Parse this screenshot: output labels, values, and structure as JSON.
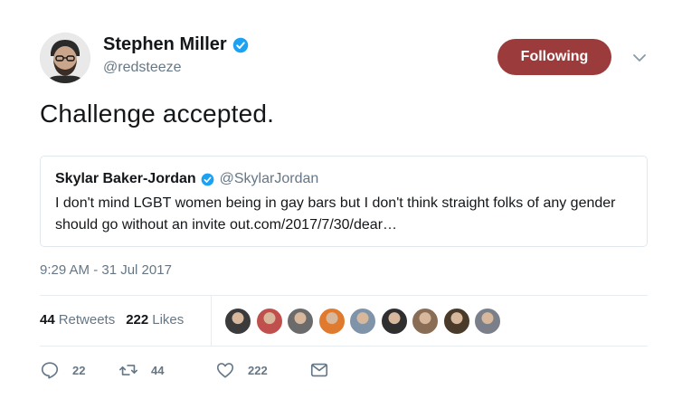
{
  "author": {
    "name": "Stephen Miller",
    "handle": "@redsteeze",
    "verified_icon": "verified-badge-icon"
  },
  "follow_button": {
    "label": "Following",
    "color": "#9b3b3b"
  },
  "tweet": {
    "text": "Challenge accepted."
  },
  "quote": {
    "name": "Skylar Baker-Jordan",
    "handle": "@SkylarJordan",
    "text": "I don't mind LGBT women being in gay bars but I don't think straight folks of any gender should go without an invite out.com/2017/7/30/dear…"
  },
  "timestamp": "9:29 AM - 31 Jul 2017",
  "stats": {
    "retweets_count": "44",
    "retweets_label": "Retweets",
    "likes_count": "222",
    "likes_label": "Likes"
  },
  "likers": [
    {
      "color": "#3b3b3b"
    },
    {
      "color": "#c0504d"
    },
    {
      "color": "#6b6b6b"
    },
    {
      "color": "#e07a2e"
    },
    {
      "color": "#7f94a8"
    },
    {
      "color": "#2f2f2f"
    },
    {
      "color": "#8a6d55"
    },
    {
      "color": "#4a3a2a"
    },
    {
      "color": "#7a7f8a"
    }
  ],
  "actions": {
    "reply_count": "22",
    "retweet_count": "44",
    "like_count": "222"
  },
  "colors": {
    "text_primary": "#14171a",
    "text_secondary": "#657786",
    "verified_blue": "#1da1f2",
    "border": "#e1e8ed"
  }
}
